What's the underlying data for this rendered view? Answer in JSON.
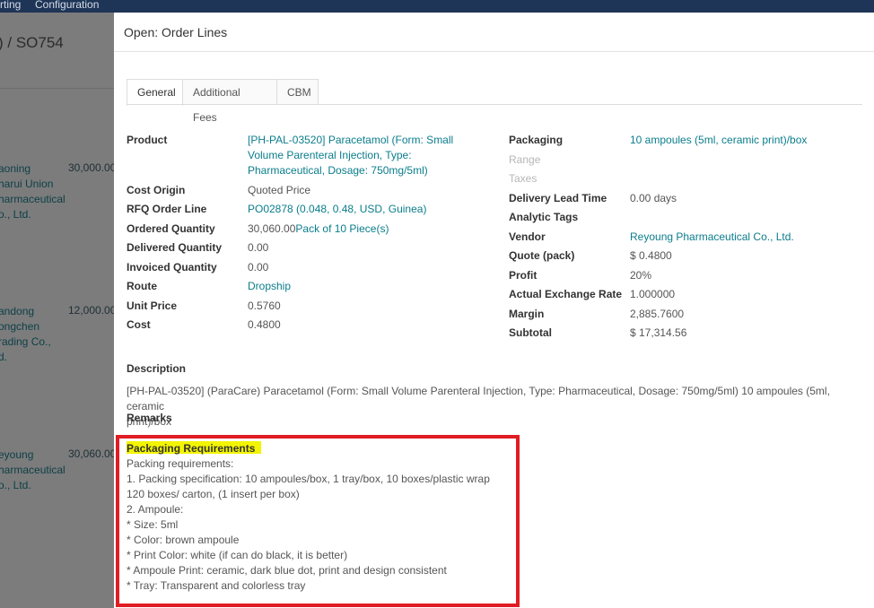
{
  "topbar": {
    "menu1": "rting",
    "menu2": "Configuration"
  },
  "background": {
    "breadcrumb": ") / SO754",
    "rows": [
      {
        "vendor": [
          "aoning",
          "harui Union",
          "harmaceutical",
          "o., Ltd."
        ],
        "qty": "30,000.00"
      },
      {
        "vendor": [
          "andong",
          "ongchen",
          "rading Co.,",
          "d."
        ],
        "qty": "12,000.00"
      },
      {
        "vendor": [
          "eyoung",
          "harmaceutical",
          "o., Ltd."
        ],
        "qty": "30,060.00"
      }
    ]
  },
  "modal": {
    "title": "Open: Order Lines",
    "tabs": [
      {
        "label": "General"
      },
      {
        "label": "Additional Fees"
      },
      {
        "label": "CBM"
      }
    ],
    "left_fields": {
      "product": {
        "label": "Product",
        "value_lines": [
          "[PH-PAL-03520] Paracetamol (Form: Small",
          "Volume Parenteral Injection, Type:",
          "Pharmaceutical, Dosage: 750mg/5ml)"
        ]
      },
      "cost_origin": {
        "label": "Cost Origin",
        "value": "Quoted Price"
      },
      "rfq_order_line": {
        "label": "RFQ Order Line",
        "value": "PO02878 (0.048, 0.48, USD, Guinea)"
      },
      "ordered_quantity": {
        "label": "Ordered Quantity",
        "value": "30,060.00",
        "uom": "Pack of 10 Piece(s)"
      },
      "delivered_quantity": {
        "label": "Delivered Quantity",
        "value": "0.00"
      },
      "invoiced_quantity": {
        "label": "Invoiced Quantity",
        "value": "0.00"
      },
      "route": {
        "label": "Route",
        "value": "Dropship"
      },
      "unit_price": {
        "label": "Unit Price",
        "value": "0.5760"
      },
      "cost": {
        "label": "Cost",
        "value": "0.4800"
      }
    },
    "right_fields": {
      "packaging": {
        "label": "Packaging",
        "value": "10 ampoules (5ml, ceramic print)/box"
      },
      "range": {
        "label": "Range"
      },
      "taxes": {
        "label": "Taxes"
      },
      "delivery_lead_time": {
        "label": "Delivery Lead Time",
        "value": "0.00 days"
      },
      "analytic_tags": {
        "label": "Analytic Tags"
      },
      "vendor": {
        "label": "Vendor",
        "value": "Reyoung Pharmaceutical Co., Ltd."
      },
      "quote_pack": {
        "label": "Quote (pack)",
        "value": "$ 0.4800"
      },
      "profit": {
        "label": "Profit",
        "value": "20%"
      },
      "actual_exchange_rate": {
        "label": "Actual Exchange Rate",
        "value": "1.000000"
      },
      "margin": {
        "label": "Margin",
        "value": "2,885.7600"
      },
      "subtotal": {
        "label": "Subtotal",
        "value": "$ 17,314.56"
      }
    },
    "description": {
      "label": "Description",
      "lines": [
        "[PH-PAL-03520] (ParaCare) Paracetamol (Form: Small Volume Parenteral Injection, Type: Pharmaceutical, Dosage: 750mg/5ml) 10 ampoules (5ml, ceramic",
        "print)/box"
      ]
    },
    "remarks": {
      "label": "Remarks"
    },
    "packaging_requirements": {
      "label": "Packaging Requirements",
      "lines": [
        "Packing requirements:",
        "1. Packing specification: 10 ampoules/box, 1 tray/box, 10 boxes/plastic wrap",
        "120 boxes/ carton, (1 insert per box)",
        "2. Ampoule:",
        "* Size: 5ml",
        "* Color:  brown ampoule",
        "* Print Color: white (if can do black, it is better)",
        "* Ampoule Print: ceramic, dark blue dot, print and design consistent",
        "* Tray: Transparent and colorless tray"
      ]
    }
  },
  "colors": {
    "link": "#0b7d8c",
    "highlight": "#f3f500",
    "annotation_box": "#e01c24",
    "topbar": "#1f3557"
  }
}
